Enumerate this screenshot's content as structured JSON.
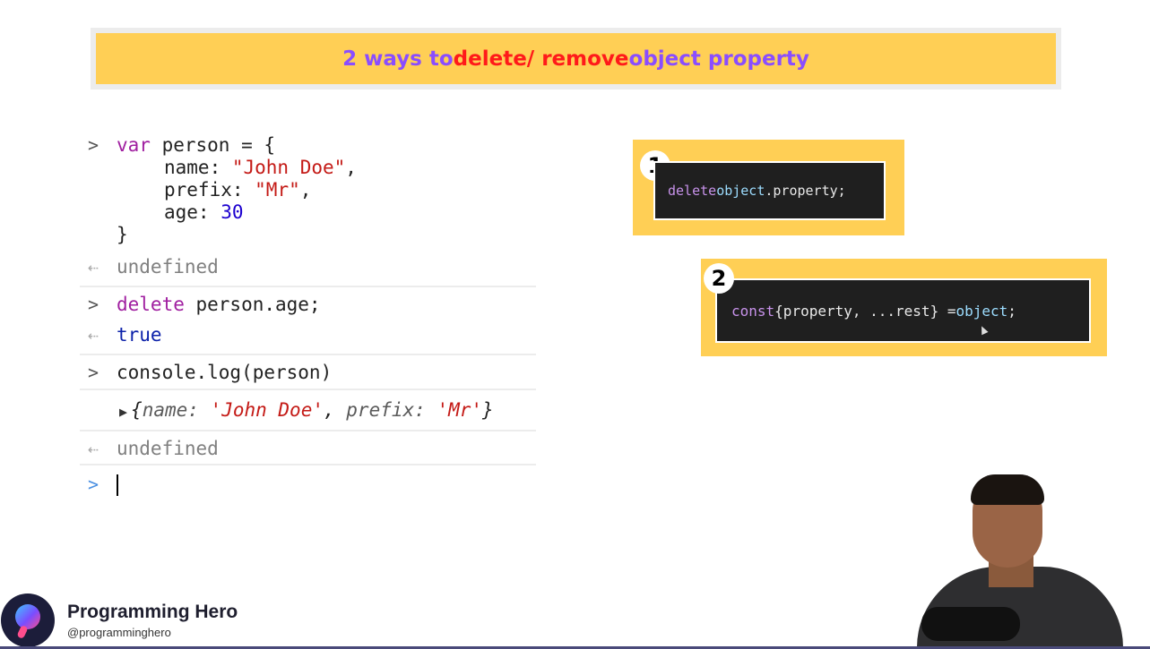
{
  "banner": {
    "part1": "2 ways to ",
    "part2": "delete/ remove",
    "part3": " object property"
  },
  "console": {
    "prompt_glyph": ">",
    "result_glyph": "⇠",
    "line1": {
      "kw": "var",
      "rest": " person = {"
    },
    "line2": {
      "key": "name: ",
      "val": "\"John Doe\"",
      "tail": ","
    },
    "line3": {
      "key": "prefix: ",
      "val": "\"Mr\"",
      "tail": ","
    },
    "line4": {
      "key": "age: ",
      "val": "30"
    },
    "line5": "}",
    "result1": "undefined",
    "cmd2": {
      "kw": "delete",
      "rest": " person.age;"
    },
    "result2": "true",
    "cmd3": "console.log(person)",
    "log": {
      "expand": "▶",
      "open": "{",
      "k1": "name: ",
      "v1": "'John Doe'",
      "sep": ", ",
      "k2": "prefix: ",
      "v2": "'Mr'",
      "close": "}"
    },
    "result3": "undefined"
  },
  "card1": {
    "badge": "1",
    "kw": "delete",
    "var": " object",
    "rest": ".property;"
  },
  "card2": {
    "badge": "2",
    "kw": "const",
    "middle": " {property, ...rest} = ",
    "var": "object",
    "tail": ";"
  },
  "brand": {
    "name": "Programming Hero",
    "handle": "@programminghero"
  },
  "colors": {
    "banner_bg": "#ffcf55",
    "banner_blue": "#8a4dff",
    "banner_red": "#ff1a1a",
    "card_bg": "#1f1f1f"
  }
}
